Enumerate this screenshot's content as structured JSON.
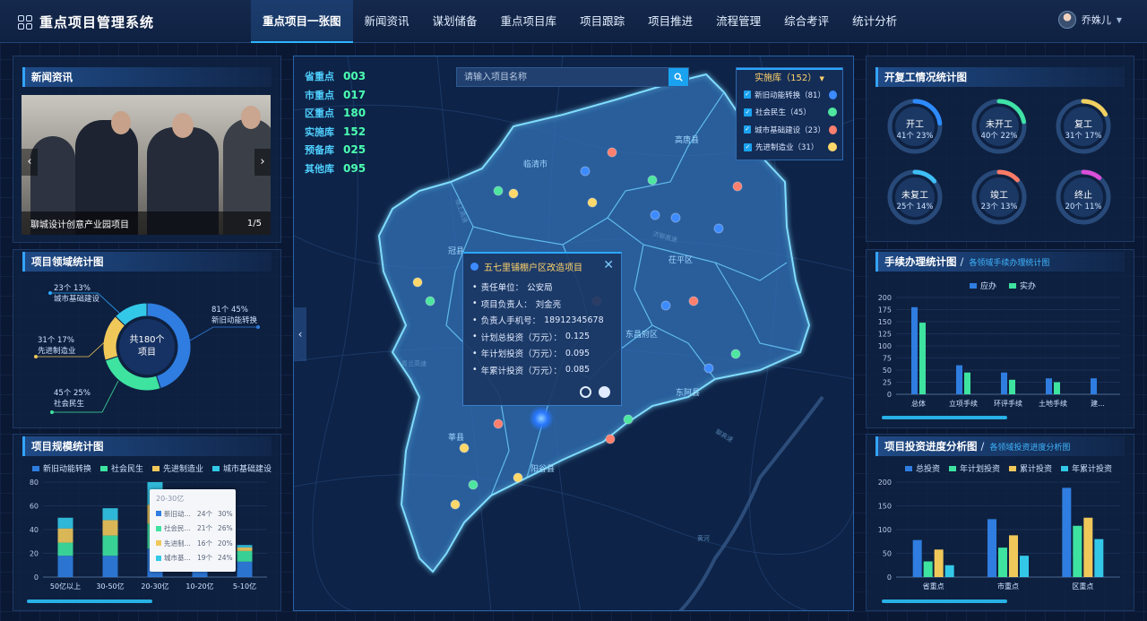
{
  "app": {
    "title": "重点项目管理系统"
  },
  "nav": [
    {
      "label": "重点项目一张图",
      "active": true
    },
    {
      "label": "新闻资讯"
    },
    {
      "label": "谋划储备"
    },
    {
      "label": "重点项目库"
    },
    {
      "label": "项目跟踪"
    },
    {
      "label": "项目推进"
    },
    {
      "label": "流程管理"
    },
    {
      "label": "综合考评"
    },
    {
      "label": "统计分析"
    }
  ],
  "user": {
    "name": "乔姝儿"
  },
  "news": {
    "title": "新闻资讯",
    "caption": "聊城设计创意产业园项目",
    "pager": "1/5"
  },
  "domain_chart": {
    "title": "项目领域统计图",
    "center_line1": "共180个",
    "center_line2": "项目",
    "labels": [
      {
        "value": "23个 13%",
        "name": "城市基础建设"
      },
      {
        "value": "31个 17%",
        "name": "先进制造业"
      },
      {
        "value": "45个 25%",
        "name": "社会民生"
      },
      {
        "value": "81个 45%",
        "name": "新旧动能转换"
      }
    ]
  },
  "scale_chart": {
    "title": "项目规模统计图",
    "legend": [
      "新旧动能转换",
      "社会民生",
      "先进制造业",
      "城市基础建设"
    ],
    "tooltip": {
      "header": "20-30亿",
      "rows": [
        {
          "name": "新旧动...",
          "count": "24个",
          "pct": "30%"
        },
        {
          "name": "社会民...",
          "count": "21个",
          "pct": "26%"
        },
        {
          "name": "先进制...",
          "count": "16个",
          "pct": "20%"
        },
        {
          "name": "城市基...",
          "count": "19个",
          "pct": "24%"
        }
      ]
    }
  },
  "map": {
    "counts": [
      {
        "label": "省重点",
        "value": "003"
      },
      {
        "label": "市重点",
        "value": "017"
      },
      {
        "label": "区重点",
        "value": "180"
      },
      {
        "label": "实施库",
        "value": "152"
      },
      {
        "label": "预备库",
        "value": "025"
      },
      {
        "label": "其他库",
        "value": "095"
      }
    ],
    "search_placeholder": "请输入项目名称",
    "layer_title": "实施库（152）",
    "layers": [
      {
        "label": "新旧动能转换（81）",
        "color": "#3d8bff"
      },
      {
        "label": "社会民生（45）",
        "color": "#4ee6a0"
      },
      {
        "label": "城市基础建设（23）",
        "color": "#ff7f6e"
      },
      {
        "label": "先进制造业（31）",
        "color": "#ffd86a"
      }
    ],
    "regions": [
      "临清市",
      "高唐县",
      "冠县",
      "茌平区",
      "东昌府区",
      "东阿县",
      "莘县",
      "阳谷县"
    ],
    "roads": [
      "德上高速",
      "济聊高速",
      "青兰高速",
      "聊高速",
      "黄河"
    ],
    "popup": {
      "title": "五七里铺棚户区改造项目",
      "rows": [
        {
          "k": "责任单位：",
          "v": "公安局"
        },
        {
          "k": "项目负责人：",
          "v": "刘金亮"
        },
        {
          "k": "负责人手机号：",
          "v": "18912345678"
        },
        {
          "k": "计划总投资（万元）：",
          "v": "0.125"
        },
        {
          "k": "年计划投资（万元）：",
          "v": "0.095"
        },
        {
          "k": "年累计投资（万元）：",
          "v": "0.085"
        }
      ]
    }
  },
  "resume_chart": {
    "title": "开复工情况统计图",
    "items": [
      {
        "name": "开工",
        "value": "41个 23%",
        "pct": 23,
        "color": "#2d8bff"
      },
      {
        "name": "未开工",
        "value": "40个 22%",
        "pct": 22,
        "color": "#3fe3a6"
      },
      {
        "name": "复工",
        "value": "31个 17%",
        "pct": 17,
        "color": "#f0d060"
      },
      {
        "name": "未复工",
        "value": "25个 14%",
        "pct": 14,
        "color": "#3fbef7"
      },
      {
        "name": "竣工",
        "value": "23个 13%",
        "pct": 13,
        "color": "#ff7b66"
      },
      {
        "name": "终止",
        "value": "20个 11%",
        "pct": 11,
        "color": "#d94fd8"
      }
    ]
  },
  "procedure_chart": {
    "title": "手续办理统计图",
    "subtitle": "各领域手续办理统计图",
    "legend": [
      "应办",
      "实办"
    ]
  },
  "invest_chart": {
    "title": "项目投资进度分析图",
    "subtitle": "各领域投资进度分析图",
    "legend": [
      "总投资",
      "年计划投资",
      "累计投资",
      "年累计投资"
    ]
  },
  "chart_data": [
    {
      "type": "pie",
      "title": "项目领域统计图",
      "categories": [
        "新旧动能转换",
        "社会民生",
        "先进制造业",
        "城市基础建设"
      ],
      "values": [
        81,
        45,
        31,
        23
      ],
      "colors": [
        "#2f7de0",
        "#3ee3a0",
        "#f0c85a",
        "#33c8e8"
      ]
    },
    {
      "type": "bar",
      "stacked": true,
      "title": "项目规模统计图",
      "categories": [
        "50亿以上",
        "30-50亿",
        "20-30亿",
        "10-20亿",
        "5-10亿"
      ],
      "ylim": [
        0,
        80
      ],
      "yticks": [
        0,
        20,
        40,
        60,
        80
      ],
      "series": [
        {
          "name": "新旧动能转换",
          "values": [
            18,
            18,
            24,
            13,
            13
          ],
          "color": "#2f7de0"
        },
        {
          "name": "社会民生",
          "values": [
            11,
            17,
            21,
            9,
            9
          ],
          "color": "#3ee3a0"
        },
        {
          "name": "先进制造业",
          "values": [
            12,
            13,
            16,
            4,
            3
          ],
          "color": "#f0c85a"
        },
        {
          "name": "城市基础建设",
          "values": [
            9,
            10,
            19,
            3,
            2
          ],
          "color": "#33c8e8"
        }
      ]
    },
    {
      "type": "bar",
      "title": "手续办理统计图",
      "categories": [
        "总体",
        "立项手续",
        "环评手续",
        "土地手续",
        "建..."
      ],
      "ylim": [
        0,
        200
      ],
      "yticks": [
        0,
        25,
        50,
        75,
        100,
        125,
        150,
        175,
        200
      ],
      "series": [
        {
          "name": "应办",
          "values": [
            180,
            60,
            45,
            33,
            33
          ],
          "color": "#2f7de0"
        },
        {
          "name": "实办",
          "values": [
            148,
            45,
            30,
            25,
            0
          ],
          "color": "#3ee3a0"
        }
      ]
    },
    {
      "type": "bar",
      "title": "项目投资进度分析图",
      "categories": [
        "省重点",
        "市重点",
        "区重点"
      ],
      "ylim": [
        0,
        200
      ],
      "yticks": [
        0,
        50,
        100,
        150,
        200
      ],
      "series": [
        {
          "name": "总投资",
          "values": [
            78,
            122,
            188
          ],
          "color": "#2f7de0"
        },
        {
          "name": "年计划投资",
          "values": [
            33,
            62,
            108
          ],
          "color": "#3ee3a0"
        },
        {
          "name": "累计投资",
          "values": [
            58,
            88,
            125
          ],
          "color": "#f0c85a"
        },
        {
          "name": "年累计投资",
          "values": [
            25,
            45,
            80
          ],
          "color": "#33c8e8"
        }
      ]
    }
  ]
}
